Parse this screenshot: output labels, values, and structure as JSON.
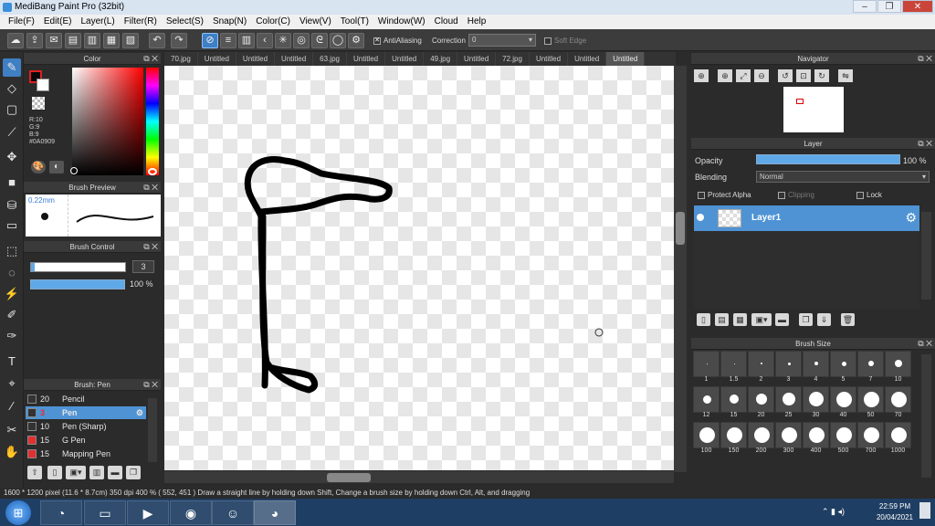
{
  "window": {
    "title": "MediBang Paint Pro (32bit)"
  },
  "menu": [
    "File(F)",
    "Edit(E)",
    "Layer(L)",
    "Filter(R)",
    "Select(S)",
    "Snap(N)",
    "Color(C)",
    "View(V)",
    "Tool(T)",
    "Window(W)",
    "Cloud",
    "Help"
  ],
  "toolbar": {
    "antialiasing_label": "AntiAliasing",
    "correction_label": "Correction",
    "correction_value": "0",
    "soft_edge_label": "Soft Edge"
  },
  "color_panel": {
    "title": "Color",
    "r": "R:10",
    "g": "G:9",
    "b": "B:9",
    "hex": "#0A0909"
  },
  "brush_preview": {
    "title": "Brush Preview",
    "size": "0.22mm"
  },
  "brush_control": {
    "title": "Brush Control",
    "size_value": "3",
    "opacity_value": "100 %"
  },
  "brush_list": {
    "title": "Brush: Pen",
    "items": [
      {
        "size": "20",
        "name": "Pencil",
        "color": "#333333"
      },
      {
        "size": "3",
        "name": "Pen",
        "color": "#333333"
      },
      {
        "size": "10",
        "name": "Pen (Sharp)",
        "color": "#333333"
      },
      {
        "size": "15",
        "name": "G Pen",
        "color": "#e03030"
      },
      {
        "size": "15",
        "name": "Mapping Pen",
        "color": "#e03030"
      }
    ]
  },
  "tabs": [
    "70.jpg",
    "Untitled",
    "Untitled",
    "Untitled",
    "63.jpg",
    "Untitled",
    "Untitled",
    "49.jpg",
    "Untitled",
    "72.jpg",
    "Untitled",
    "Untitled",
    "Untitled"
  ],
  "navigator": {
    "title": "Navigator"
  },
  "layer_panel": {
    "title": "Layer",
    "opacity_label": "Opacity",
    "opacity_value": "100 %",
    "blending_label": "Blending",
    "blending_value": "Normal",
    "protect_alpha": "Protect Alpha",
    "clipping": "Clipping",
    "lock": "Lock",
    "layer_name": "Layer1"
  },
  "brush_size": {
    "title": "Brush Size",
    "sizes": [
      "1",
      "1.5",
      "2",
      "3",
      "4",
      "5",
      "7",
      "10",
      "12",
      "15",
      "20",
      "25",
      "30",
      "40",
      "50",
      "70",
      "100",
      "150",
      "200",
      "300",
      "400",
      "500",
      "700",
      "1000"
    ]
  },
  "status": {
    "text": "1600 * 1200 pixel   (11.6 * 8.7cm)   350 dpi   400 %   ( 552, 451 )   Draw a straight line by holding down Shift, Change a brush size by holding down Ctrl, Alt, and dragging"
  },
  "taskbar": {
    "time": "22:59 PM",
    "date": "20/04/2021"
  }
}
